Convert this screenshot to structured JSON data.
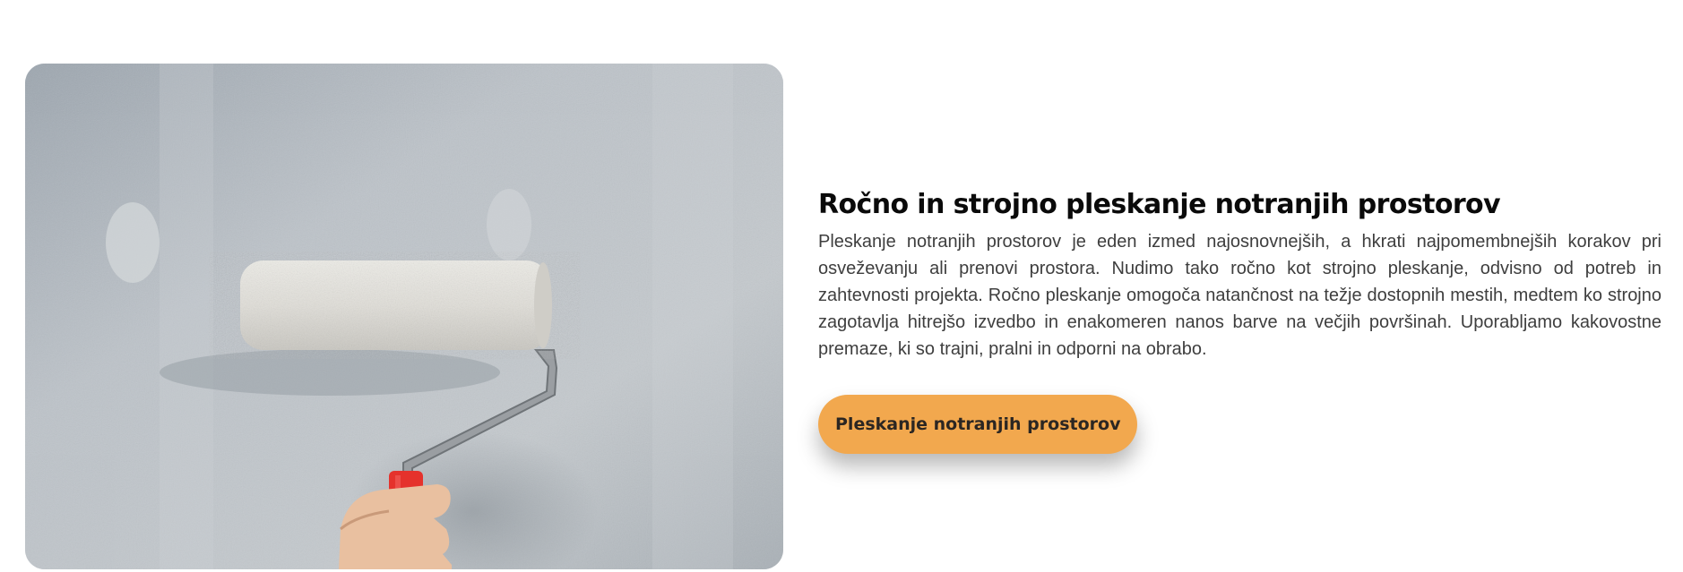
{
  "service": {
    "image_alt": "paint-roller-on-wall-photo",
    "heading": "Ročno in strojno pleskanje notranjih prostorov",
    "description": "Pleskanje notranjih prostorov je eden izmed najosnovnejših, a hkrati najpomembnejših korakov pri osveževanju ali prenovi prostora. Nudimo tako ročno kot strojno pleskanje, odvisno od potreb in zahtevnosti projekta. Ročno pleskanje omogoča natančnost na težje dostopnih mestih, medtem ko strojno zagotavlja hitrejšo izvedbo in enakomeren nanos barve na večjih površinah. Uporabljamo kakovostne premaze, ki so trajni, pralni in odporni na obrabo.",
    "button_label": "Pleskanje notranjih prostorov"
  },
  "colors": {
    "accent": "#f2a84e",
    "heading": "#0a0a0a",
    "body": "#3e3e3e",
    "roller_handle": "#e5322c"
  }
}
